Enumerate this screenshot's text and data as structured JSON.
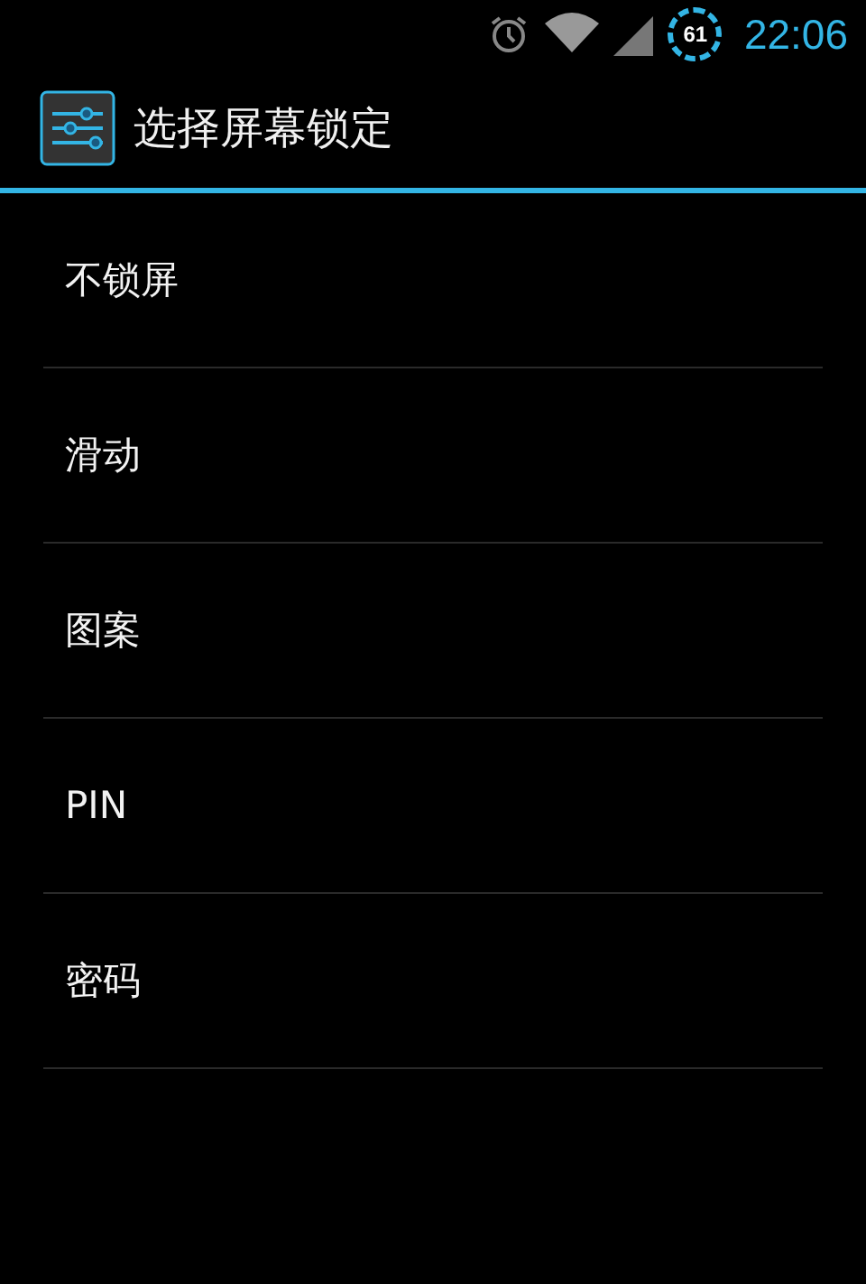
{
  "status_bar": {
    "battery": "61",
    "time": "22:06"
  },
  "title_bar": {
    "title": "选择屏幕锁定"
  },
  "options": [
    {
      "label": "不锁屏"
    },
    {
      "label": "滑动"
    },
    {
      "label": "图案"
    },
    {
      "label": "PIN"
    },
    {
      "label": "密码"
    }
  ]
}
